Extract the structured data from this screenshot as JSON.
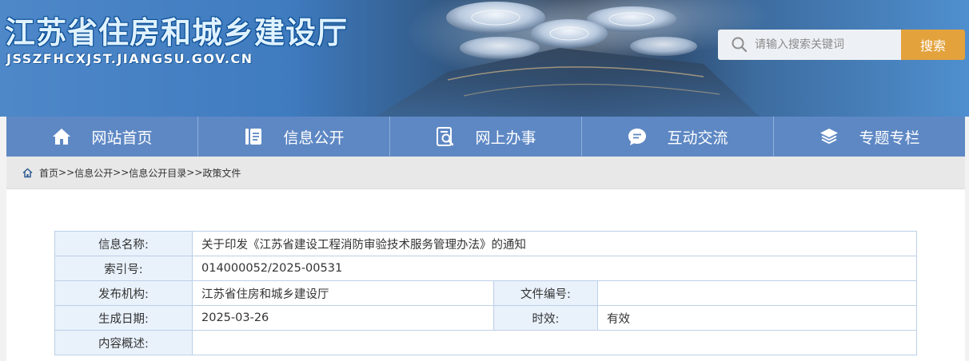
{
  "header": {
    "site_title": "江苏省住房和城乡建设厅",
    "site_domain": "JSSZFHCXJST.JIANGSU.GOV.CN",
    "search": {
      "placeholder": "请输入搜索关键词",
      "value": "",
      "button_label": "搜索"
    }
  },
  "nav": {
    "items": [
      {
        "label": "网站首页",
        "icon": "home-icon"
      },
      {
        "label": "信息公开",
        "icon": "document-icon"
      },
      {
        "label": "网上办事",
        "icon": "search-document-icon"
      },
      {
        "label": "互动交流",
        "icon": "chat-icon"
      },
      {
        "label": "专题专栏",
        "icon": "layers-icon"
      }
    ]
  },
  "breadcrumb": {
    "icon": "home-icon",
    "items": [
      "首页",
      "信息公开",
      "信息公开目录",
      "政策文件"
    ],
    "separator": ">>"
  },
  "info": {
    "name_label": "信息名称:",
    "name_value": "关于印发《江苏省建设工程消防审验技术服务管理办法》的通知",
    "index_label": "索引号:",
    "index_value": "014000052/2025-00531",
    "publisher_label": "发布机构:",
    "publisher_value": "江苏省住房和城乡建设厅",
    "doc_number_label": "文件编号:",
    "doc_number_value": "",
    "date_label": "生成日期:",
    "date_value": "2025-03-26",
    "validity_label": "时效:",
    "validity_value": "有效",
    "summary_label": "内容概述:",
    "summary_value": ""
  },
  "colors": {
    "nav_background": "#5e88c4",
    "search_button": "#e3a23c",
    "label_cell": "#e9f1fb",
    "table_border": "#bcd0e8"
  }
}
